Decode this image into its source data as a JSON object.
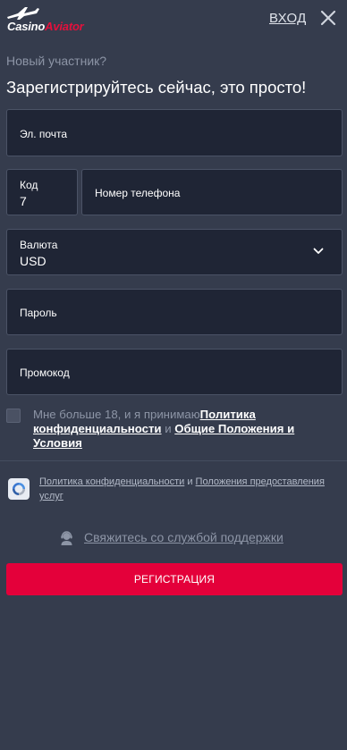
{
  "header": {
    "logo": {
      "word1": "Casino",
      "word2": "Aviator"
    },
    "login_label": "ВХОД",
    "close_icon": "close-icon"
  },
  "intro": {
    "subtitle": "Новый участник?",
    "title": "Зарегистрируйтесь сейчас, это просто!"
  },
  "form": {
    "email": {
      "label": "Эл. почта"
    },
    "code": {
      "label": "Код",
      "value": "7"
    },
    "phone": {
      "label": "Номер телефона"
    },
    "currency": {
      "label": "Валюта",
      "value": "USD",
      "icon": "chevron-down-icon"
    },
    "password": {
      "label": "Пароль"
    },
    "promo": {
      "label": "Промокод"
    }
  },
  "terms": {
    "checked": false,
    "text_before": "Мне больше 18, и я принимаю",
    "privacy_link": "Политика конфиденциальности",
    "and": " и ",
    "terms_link": "Общие Положения и Условия"
  },
  "recaptcha": {
    "privacy_link": "Политика конфиденциальности",
    "and": " и ",
    "terms_link": "Положения предоставления услуг"
  },
  "support": {
    "icon": "support-agent-icon",
    "label": "Свяжитесь со службой поддержки"
  },
  "register_button": {
    "label": "РЕГИСТРАЦИЯ"
  },
  "colors": {
    "background": "#353c4d",
    "field_background": "#1f2535",
    "field_border": "#4b5366",
    "accent": "#e4003a",
    "muted_text": "#8d95a6"
  }
}
